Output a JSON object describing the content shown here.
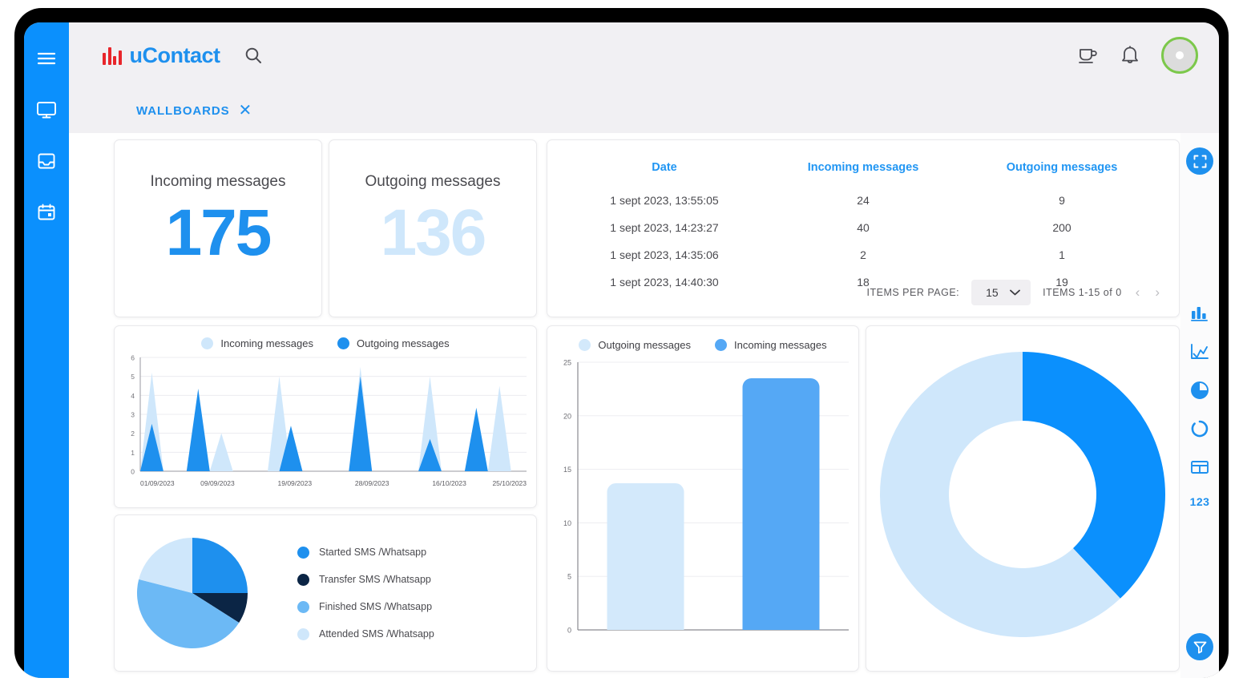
{
  "app": {
    "logo_text": "uContact",
    "accent_blue": "#1e90ee",
    "rail_blue": "#0b90fd",
    "pale_blue": "#cfe7fb",
    "mid_blue": "#6cb9f5",
    "navy": "#0b2545",
    "logo_red": "#e8262b",
    "avatar_ring": "#7cc84b"
  },
  "left_rail": {
    "items": [
      {
        "name": "menu-icon",
        "label": "Menu"
      },
      {
        "name": "desktop-icon",
        "label": "Desktop"
      },
      {
        "name": "inbox-icon",
        "label": "Inbox"
      },
      {
        "name": "calendar-icon",
        "label": "Calendar"
      }
    ]
  },
  "header": {
    "search_icon": "search-icon",
    "coffee_icon": "coffee-cup-icon",
    "bell_icon": "bell-icon",
    "avatar_icon": "avatar"
  },
  "tabs": {
    "active_label": "WALLBOARDS",
    "close_glyph": "✕"
  },
  "kpi": {
    "incoming": {
      "title": "Incoming messages",
      "value": "175"
    },
    "outgoing": {
      "title": "Outgoing messages",
      "value": "136"
    }
  },
  "table": {
    "headers": [
      "Date",
      "Incoming messages",
      "Outgoing messages"
    ],
    "rows": [
      {
        "date": "1 sept 2023, 13:55:05",
        "incoming": "24",
        "outgoing": "9"
      },
      {
        "date": "1 sept 2023, 14:23:27",
        "incoming": "40",
        "outgoing": "200"
      },
      {
        "date": "1 sept 2023, 14:35:06",
        "incoming": "2",
        "outgoing": "1"
      },
      {
        "date": "1 sept 2023, 14:40:30",
        "incoming": "18",
        "outgoing": "19"
      }
    ],
    "pager": {
      "items_per_page_label": "ITEMS PER PAGE:",
      "items_per_page_value": "15",
      "range_label": "ITEMS 1-15 of 0",
      "prev_glyph": "‹",
      "next_glyph": "›",
      "chevron_glyph": "chevron-down-icon"
    }
  },
  "chart_data": [
    {
      "id": "area-chart",
      "type": "area",
      "title": "",
      "xlabel": "",
      "ylabel": "",
      "ylim": [
        0,
        6
      ],
      "yticks": [
        0,
        1,
        2,
        3,
        4,
        5,
        6
      ],
      "xticks": [
        "01/09/2023",
        "09/09/2023",
        "19/09/2023",
        "28/09/2023",
        "16/10/2023",
        "25/10/2023"
      ],
      "grid": true,
      "legend_position": "top",
      "legend": [
        "Incoming messages",
        "Outgoing messages"
      ],
      "colors": [
        "#cfe7fb",
        "#1e90ee"
      ],
      "x": [
        0,
        3,
        6,
        9,
        12,
        15,
        18,
        21,
        24,
        27,
        30,
        33,
        36,
        39,
        42,
        45,
        48,
        51,
        54,
        57,
        60,
        63,
        66,
        69,
        72,
        75,
        78,
        81,
        84,
        87,
        90,
        93,
        96,
        100
      ],
      "series": [
        {
          "name": "Incoming messages",
          "values": [
            0,
            5.2,
            0,
            0,
            0,
            0,
            0,
            2,
            0,
            0,
            0,
            0,
            5,
            0,
            0,
            0,
            0,
            0,
            0,
            5.5,
            0,
            0,
            0,
            0,
            0,
            5,
            0,
            0,
            0,
            0,
            0,
            4.5,
            0,
            0
          ]
        },
        {
          "name": "Outgoing messages",
          "values": [
            0,
            2.5,
            0,
            0,
            0,
            4.35,
            0,
            0,
            0,
            0,
            0,
            0,
            0,
            2.4,
            0,
            0,
            0,
            0,
            0,
            5,
            0,
            0,
            0,
            0,
            0,
            1.7,
            0,
            0,
            0,
            3.35,
            0,
            0,
            0,
            0
          ]
        }
      ]
    },
    {
      "id": "bar-chart",
      "type": "bar",
      "title": "",
      "xlabel": "",
      "ylabel": "",
      "ylim": [
        0,
        25
      ],
      "yticks": [
        0,
        5,
        10,
        15,
        20,
        25
      ],
      "grid": true,
      "legend_position": "top",
      "legend": [
        "Outgoing messages",
        "Incoming messages"
      ],
      "colors": [
        "#d3e9fb",
        "#55a8f5"
      ],
      "categories": [
        "Outgoing messages",
        "Incoming messages"
      ],
      "values": [
        13.7,
        23.5
      ]
    },
    {
      "id": "pie-chart",
      "type": "pie",
      "title": "",
      "legend_position": "right",
      "labels": [
        "Started SMS /Whatsapp",
        "Transfer SMS /Whatsapp",
        "Finished SMS /Whatsapp",
        "Attended SMS /Whatsapp"
      ],
      "colors": [
        "#1e90ee",
        "#0b2545",
        "#6cb9f5",
        "#cfe7fb"
      ],
      "values": [
        25,
        9,
        45,
        21
      ]
    },
    {
      "id": "donut-chart",
      "type": "pie",
      "title": "",
      "donut": true,
      "legend_position": "none",
      "labels": [
        "Incoming messages",
        "Outgoing messages"
      ],
      "colors": [
        "#0b90fd",
        "#cfe7fb"
      ],
      "values": [
        38,
        62
      ]
    }
  ],
  "right_rail": {
    "fullscreen_icon": "fullscreen-icon",
    "items": [
      {
        "name": "bar-chart-icon"
      },
      {
        "name": "line-chart-icon"
      },
      {
        "name": "pie-chart-icon"
      },
      {
        "name": "donut-chart-icon"
      },
      {
        "name": "table-icon"
      }
    ],
    "number_widget_label": "123",
    "filter_icon": "filter-icon"
  }
}
